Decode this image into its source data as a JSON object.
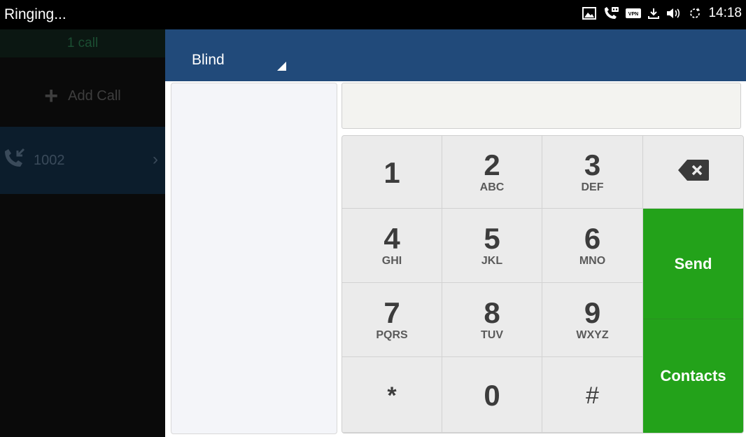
{
  "status_bar": {
    "text": "Ringing...",
    "time": "14:18",
    "icons": [
      "picture-icon",
      "voicemail-call-icon",
      "vpn-icon",
      "download-icon",
      "volume-icon",
      "sync-icon"
    ],
    "vpn_label": "VPN"
  },
  "left_panel": {
    "calls_count": "1 call",
    "add_call_label": "Add Call",
    "call_item": {
      "number": "1002",
      "icon": "incoming-call-icon"
    }
  },
  "transfer": {
    "mode_label": "Blind",
    "number_value": "",
    "keys": [
      {
        "digit": "1",
        "letters": ""
      },
      {
        "digit": "2",
        "letters": "ABC"
      },
      {
        "digit": "3",
        "letters": "DEF"
      },
      {
        "digit": "4",
        "letters": "GHI"
      },
      {
        "digit": "5",
        "letters": "JKL"
      },
      {
        "digit": "6",
        "letters": "MNO"
      },
      {
        "digit": "7",
        "letters": "PQRS"
      },
      {
        "digit": "8",
        "letters": "TUV"
      },
      {
        "digit": "9",
        "letters": "WXYZ"
      },
      {
        "digit": "*",
        "letters": ""
      },
      {
        "digit": "0",
        "letters": ""
      },
      {
        "digit": "#",
        "letters": ""
      }
    ],
    "send_label": "Send",
    "contacts_label": "Contacts"
  },
  "colors": {
    "header_blue": "#214a7a",
    "action_green": "#23a21a"
  }
}
